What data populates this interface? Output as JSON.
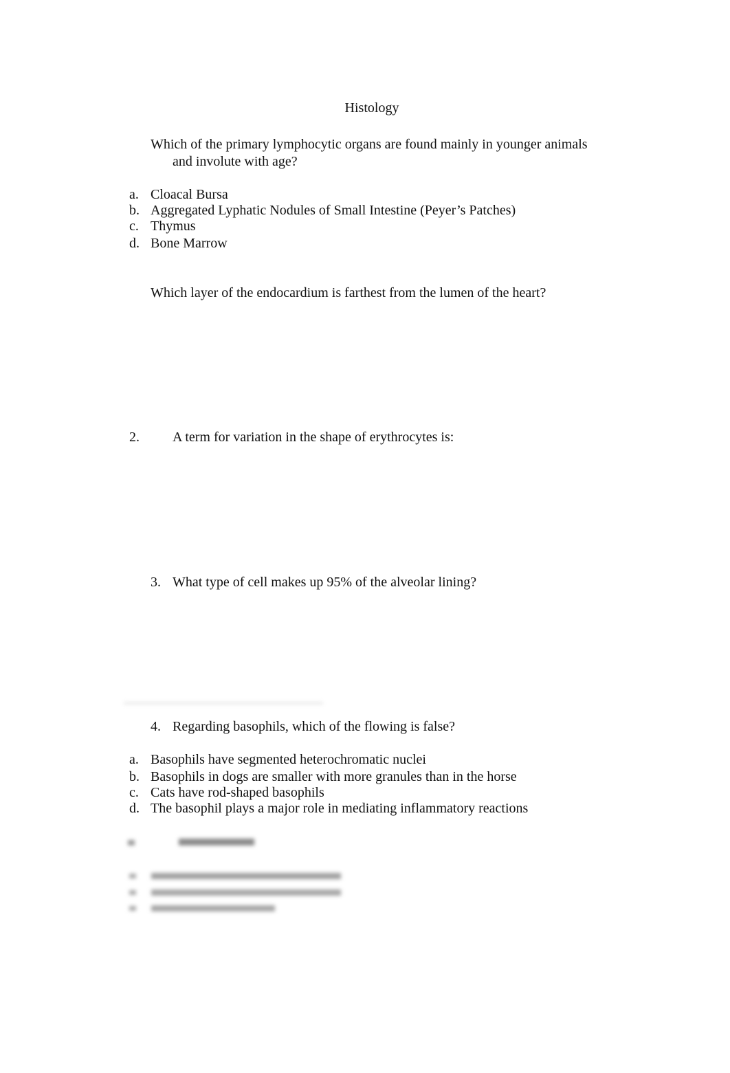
{
  "document": {
    "title": "Histology",
    "questions": [
      {
        "number": "",
        "text_line1": "Which of the primary lymphocytic organs are found mainly in younger animals",
        "text_line2": "and involute with age?",
        "options": [
          {
            "letter": "a.",
            "text": "Cloacal Bursa"
          },
          {
            "letter": "b.",
            "text": "Aggregated Lyphatic Nodules of Small Intestine (Peyer’s Patches)"
          },
          {
            "letter": "c.",
            "text": "Thymus"
          },
          {
            "letter": "d.",
            "text": "Bone Marrow"
          }
        ]
      },
      {
        "number": "",
        "text": "Which layer of the endocardium is farthest from the lumen of the heart?"
      },
      {
        "number": "2.",
        "text": "A term for variation in the shape of erythrocytes is:"
      },
      {
        "number": "3.",
        "text": "What type of cell makes up 95% of the alveolar lining?"
      },
      {
        "number": "4.",
        "text": "Regarding basophils, which of the flowing is false?",
        "options": [
          {
            "letter": "a.",
            "text": "Basophils have segmented heterochromatic nuclei"
          },
          {
            "letter": "b.",
            "text": "Basophils in dogs are smaller with more granules than in the horse"
          },
          {
            "letter": "c.",
            "text": "Cats have rod-shaped basophils"
          },
          {
            "letter": "d.",
            "text": "The basophil plays a major role in mediating inflammatory reactions"
          }
        ]
      }
    ],
    "blurred_section": {
      "note": "obscured content"
    }
  }
}
